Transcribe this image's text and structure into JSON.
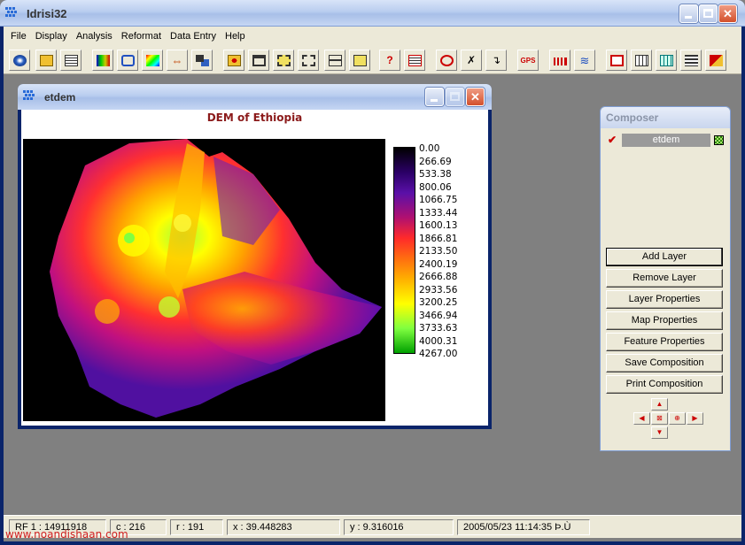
{
  "window": {
    "title": "Idrisi32"
  },
  "menu": [
    "File",
    "Display",
    "Analysis",
    "Reformat",
    "Data Entry",
    "Help"
  ],
  "toolbar": {
    "icons": [
      "display-launcher-icon",
      "open-folder-icon",
      "list-icon",
      "image-palette-icon",
      "digitize-icon",
      "rainbow-palette-icon",
      "pan-arrows-icon",
      "overlay-icon",
      "zoom-icon",
      "window-icon",
      "select-box-icon",
      "query-box-icon",
      "connect-icon",
      "link-icon",
      "help-query-icon",
      "table-edit-icon",
      "target-icon",
      "tools-icon",
      "arrow-icon",
      "gps-icon",
      "histogram-icon",
      "wave-icon",
      "import-icon",
      "grid-icon",
      "table-icon",
      "bars-icon",
      "eraser-icon"
    ],
    "gps_label": "GPS"
  },
  "map_window": {
    "title": "etdem",
    "map_title": "DEM of Ethiopia",
    "legend": [
      "0.00",
      "266.69",
      "533.38",
      "800.06",
      "1066.75",
      "1333.44",
      "1600.13",
      "1866.81",
      "2133.50",
      "2400.19",
      "2666.88",
      "2933.56",
      "3200.25",
      "3466.94",
      "3733.63",
      "4000.31",
      "4267.00"
    ]
  },
  "composer": {
    "title": "Composer",
    "layer": "etdem",
    "buttons": [
      "Add Layer",
      "Remove Layer",
      "Layer Properties",
      "Map Properties",
      "Feature Properties",
      "Save Composition",
      "Print Composition"
    ]
  },
  "status": {
    "rf": "RF  1 : 14911918",
    "c": "c : 216",
    "r": "r : 191",
    "x": "x :  39.448283",
    "y": "y :   9.316016",
    "datetime": "2005/05/23 11:14:35 Þ.Ù"
  },
  "watermark": "www.noandishaan.com",
  "colors": {
    "title_gradient": "#b9cdef",
    "map_title": "#8b1a1a",
    "watermark": "#d02020"
  }
}
